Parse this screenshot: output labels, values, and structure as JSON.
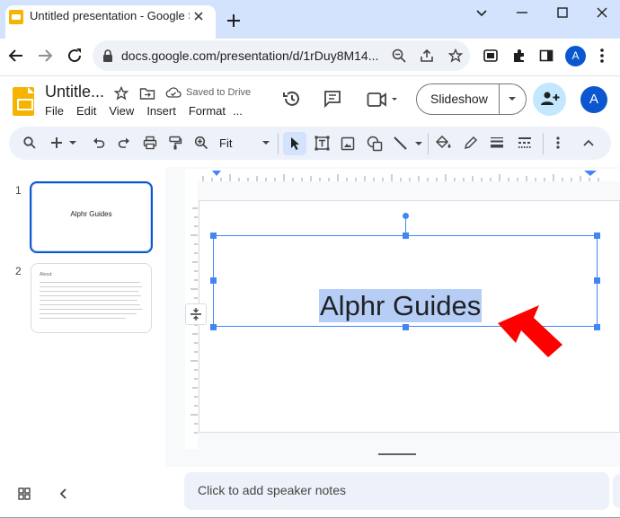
{
  "browser": {
    "tab_title": "Untitled presentation - Google Sl",
    "url": "docs.google.com/presentation/d/1rDuy8M14...",
    "profile_initial": "A"
  },
  "slides": {
    "doc_title": "Untitle...",
    "saved_status": "Saved to Drive",
    "menu": [
      "File",
      "Edit",
      "View",
      "Insert",
      "Format",
      "..."
    ],
    "slideshow_label": "Slideshow",
    "account_initial": "A",
    "zoom": "Fit"
  },
  "filmstrip": {
    "slides": [
      {
        "number": "1",
        "text": "Alphr Guides"
      },
      {
        "number": "2",
        "title": "About:",
        "body_lines": 9
      }
    ]
  },
  "canvas": {
    "selected_text": "Alphr Guides"
  },
  "notes": {
    "placeholder": "Click to add speaker notes"
  },
  "colors": {
    "accent": "#0b57d0",
    "selection": "#b6cef6",
    "arrow": "#ff0000",
    "slides_logo": "#f4b400"
  }
}
